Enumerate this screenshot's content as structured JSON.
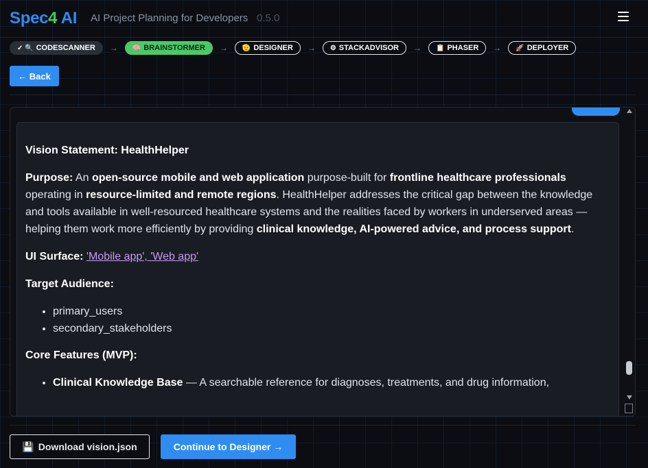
{
  "header": {
    "logo": {
      "part1": "Spec",
      "part2": "4",
      "part3": " AI"
    },
    "tagline": "AI Project Planning for Developers",
    "version": "0.5.0"
  },
  "steps": [
    {
      "label": "CODESCANNER",
      "icon": "✓ 🔍",
      "state": "done"
    },
    {
      "label": "BRAINSTORMER",
      "icon": "🧠",
      "state": "active"
    },
    {
      "label": "DESIGNER",
      "icon": "🫡",
      "state": "pending"
    },
    {
      "label": "STACKADVISOR",
      "icon": "⚙",
      "state": "pending"
    },
    {
      "label": "PHASER",
      "icon": "📋",
      "state": "pending"
    },
    {
      "label": "DEPLOYER",
      "icon": "🚀",
      "state": "pending"
    }
  ],
  "step_arrow": "→",
  "back_button": "← Back",
  "vision": {
    "title": "Vision Statement: HealthHelper",
    "purpose_label": "Purpose:",
    "purpose": {
      "t1": "An",
      "b1": "open-source mobile and web application",
      "t2": "purpose-built for",
      "b2": "frontline healthcare professionals",
      "t3": "operating in",
      "b3": "resource-limited and remote regions",
      "t4": ". HealthHelper addresses the critical gap between the knowledge and tools available in well-resourced healthcare systems and the realities faced by workers in underserved areas — helping them work more efficiently by providing",
      "b4": "clinical knowledge, AI-powered advice, and process support",
      "t5": "."
    },
    "ui_surface_label": "UI Surface:",
    "ui_surface_value": "'Mobile app', 'Web app'",
    "audience_label": "Target Audience:",
    "audience": [
      "primary_users",
      "secondary_stakeholders"
    ],
    "features_label": "Core Features (MVP):",
    "features": [
      {
        "name": "Clinical Knowledge Base",
        "desc": "— A searchable reference for diagnoses, treatments, and drug information,"
      }
    ]
  },
  "download_button": {
    "icon": "💾",
    "label": "Download vision.json"
  },
  "continue_button": "Continue to Designer →"
}
